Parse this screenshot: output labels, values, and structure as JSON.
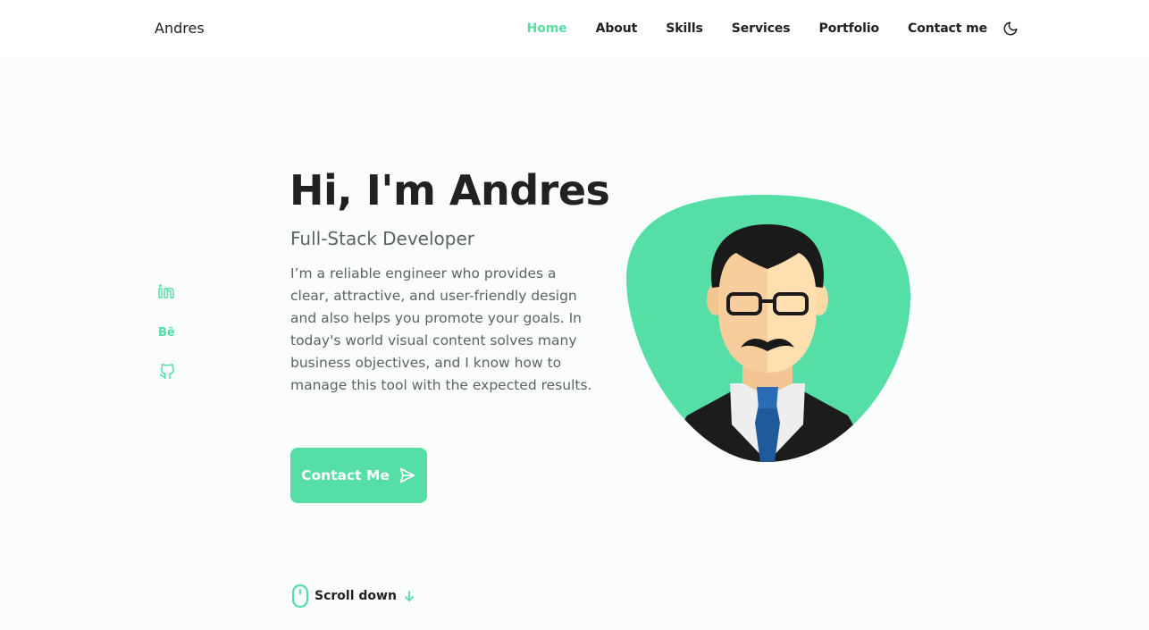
{
  "header": {
    "logo": "Andres",
    "nav": [
      "Home",
      "About",
      "Skills",
      "Services",
      "Portfolio",
      "Contact me"
    ],
    "active_nav": "Home",
    "theme_icon": "moon-icon"
  },
  "socials": [
    {
      "name": "linkedin-icon",
      "label": "in"
    },
    {
      "name": "behance-icon",
      "label": "Bē"
    },
    {
      "name": "github-icon",
      "label": "github"
    }
  ],
  "hero": {
    "title": "Hi, I'm Andres",
    "subtitle": "Full-Stack Developer",
    "description": "I’m a reliable engineer who provides a clear, attractive, and user-friendly design and also helps you promote your goals. In today's world visual content solves many business objectives, and I know how to manage this tool with the expected results.",
    "cta_label": "Contact Me"
  },
  "scroll": {
    "label": "Scroll down"
  },
  "colors": {
    "accent": "#55dea5",
    "text": "#212121",
    "muted": "#5c6364",
    "background": "#fbfdfd"
  }
}
